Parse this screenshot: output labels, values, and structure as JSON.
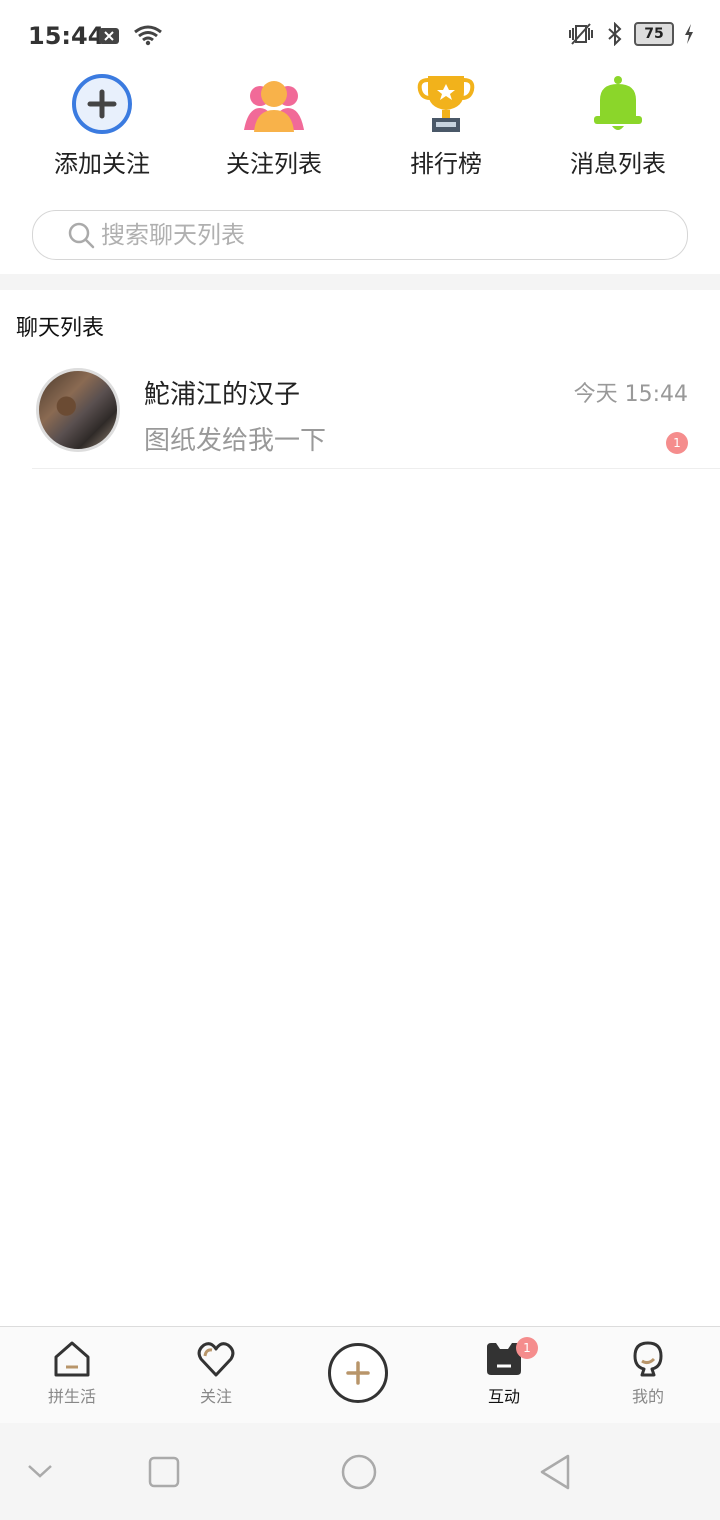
{
  "status_bar": {
    "time": "15:44",
    "battery": "75"
  },
  "quick_actions": [
    {
      "label": "添加关注",
      "icon": "add-circle-icon",
      "color": "#3b7be0"
    },
    {
      "label": "关注列表",
      "icon": "users-icon",
      "color": "#f7a64a"
    },
    {
      "label": "排行榜",
      "icon": "trophy-icon",
      "color": "#f2b21b"
    },
    {
      "label": "消息列表",
      "icon": "bell-icon",
      "color": "#8bd62a"
    }
  ],
  "search": {
    "placeholder": "搜索聊天列表"
  },
  "chat_section": {
    "title": "聊天列表",
    "items": [
      {
        "name": "鮀浦江的汉子",
        "time": "今天 15:44",
        "preview": "图纸发给我一下",
        "unread": "1"
      }
    ]
  },
  "tab_bar": {
    "tabs": [
      {
        "label": "拼生活",
        "icon": "home-icon"
      },
      {
        "label": "关注",
        "icon": "heart-icon"
      },
      {
        "label": "",
        "icon": "plus-icon"
      },
      {
        "label": "互动",
        "icon": "chat-icon",
        "badge": "1"
      },
      {
        "label": "我的",
        "icon": "profile-icon"
      }
    ],
    "active": "互动"
  }
}
